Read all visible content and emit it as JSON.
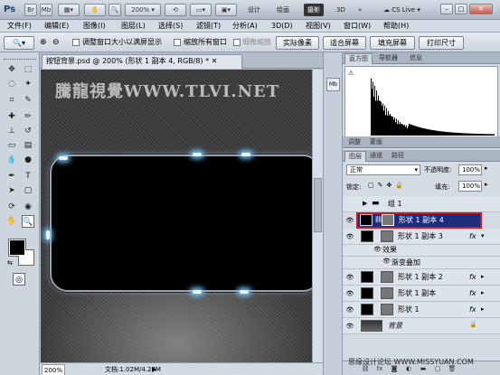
{
  "titlebar": {
    "app_logo": "Ps",
    "zoom": "200%",
    "workspaces": [
      "设计",
      "绘画",
      "摄影",
      "3D"
    ],
    "active_workspace": "摄影",
    "cslive": "CS Live"
  },
  "menus": [
    "文件(F)",
    "编辑(E)",
    "图像(I)",
    "图层(L)",
    "选择(S)",
    "滤镜(T)",
    "分析(A)",
    "3D(D)",
    "视图(V)",
    "窗口(W)",
    "帮助(H)"
  ],
  "options": {
    "resize_windows": "调整窗口大小以满屏显示",
    "zoom_all": "缩放所有窗口",
    "scrubby_zoom": "细微缩放",
    "actual_pixels": "实际像素",
    "fit_screen": "适合屏幕",
    "fill_screen": "填充屏幕",
    "print_size": "打印尺寸"
  },
  "document": {
    "tab": "按钮背景.psd @ 200% (形状 1 副本 4, RGB/8) *",
    "watermark": "騰龍視覺WWW.TLVI.NET",
    "zoom": "200%",
    "doc_size": "文档:1.02M/4.27M"
  },
  "panels": {
    "top_tabs": [
      "直方图",
      "导航器",
      "信息"
    ],
    "adjust_tabs": [
      "调整",
      "蒙版"
    ],
    "layer_tabs": [
      "图层",
      "通道",
      "路径"
    ],
    "blend_mode": "正常",
    "opacity_label": "不透明度:",
    "opacity": "100%",
    "lock_label": "锁定:",
    "fill_label": "填充:",
    "fill": "100%",
    "layers": [
      {
        "name": "组 1",
        "kind": "group"
      },
      {
        "name": "形状 1 副本 4",
        "kind": "shape",
        "selected": true
      },
      {
        "name": "形状 1 副本 3",
        "kind": "shape",
        "fx": true
      },
      {
        "name": "效果",
        "kind": "effect"
      },
      {
        "name": "渐变叠加",
        "kind": "effect2"
      },
      {
        "name": "形状 1 副本 2",
        "kind": "shape",
        "fx": true
      },
      {
        "name": "形状 1 副本",
        "kind": "shape",
        "fx": true
      },
      {
        "name": "形状 1",
        "kind": "shape",
        "fx": true
      },
      {
        "name": "背景",
        "kind": "bg"
      }
    ]
  },
  "footer": "思缘设计论坛 WWW.MISSYUAN.COM",
  "colors": {
    "selected_layer": "#1b2e7e",
    "canvas": "#3a3a3a"
  }
}
